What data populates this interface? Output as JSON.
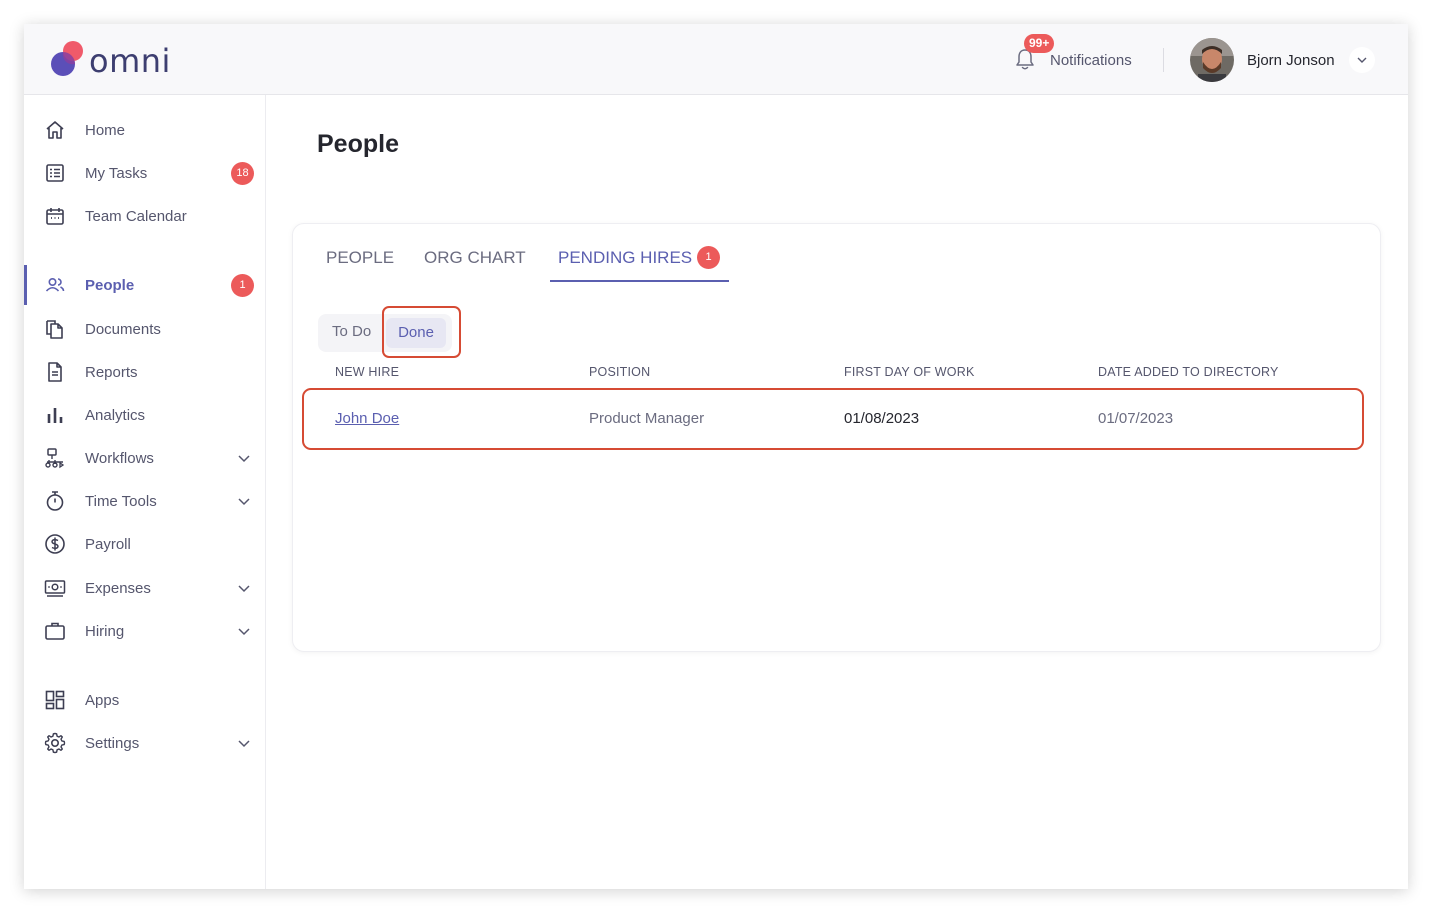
{
  "app": {
    "logo_text": "omni"
  },
  "header": {
    "notifications_label": "Notifications",
    "notifications_count": "99+",
    "user_name": "Bjorn Jonson"
  },
  "sidebar": {
    "items": [
      {
        "label": "Home",
        "icon": "home-icon"
      },
      {
        "label": "My Tasks",
        "icon": "tasks-icon",
        "badge": "18"
      },
      {
        "label": "Team Calendar",
        "icon": "calendar-icon"
      },
      {
        "label": "People",
        "icon": "people-icon",
        "badge": "1",
        "active": true
      },
      {
        "label": "Documents",
        "icon": "documents-icon"
      },
      {
        "label": "Reports",
        "icon": "reports-icon"
      },
      {
        "label": "Analytics",
        "icon": "analytics-icon"
      },
      {
        "label": "Workflows",
        "icon": "workflows-icon",
        "expandable": true
      },
      {
        "label": "Time Tools",
        "icon": "stopwatch-icon",
        "expandable": true
      },
      {
        "label": "Payroll",
        "icon": "dollar-icon"
      },
      {
        "label": "Expenses",
        "icon": "expenses-icon",
        "expandable": true
      },
      {
        "label": "Hiring",
        "icon": "briefcase-icon",
        "expandable": true
      },
      {
        "label": "Apps",
        "icon": "apps-icon"
      },
      {
        "label": "Settings",
        "icon": "gear-icon",
        "expandable": true
      }
    ]
  },
  "main": {
    "title": "People",
    "tabs": [
      {
        "label": "PEOPLE"
      },
      {
        "label": "ORG CHART"
      },
      {
        "label": "PENDING HIRES",
        "badge": "1",
        "active": true
      }
    ],
    "segments": {
      "todo": "To Do",
      "done": "Done",
      "selected": "Done"
    },
    "table": {
      "headers": [
        "NEW HIRE",
        "POSITION",
        "FIRST DAY OF WORK",
        "DATE ADDED TO DIRECTORY"
      ],
      "rows": [
        {
          "name": "John Doe",
          "position": "Product Manager",
          "first_day": "01/08/2023",
          "date_added": "01/07/2023"
        }
      ]
    }
  },
  "colors": {
    "accent": "#5b5fb0",
    "badge": "#ec5a5a",
    "highlight": "#d64b34"
  }
}
